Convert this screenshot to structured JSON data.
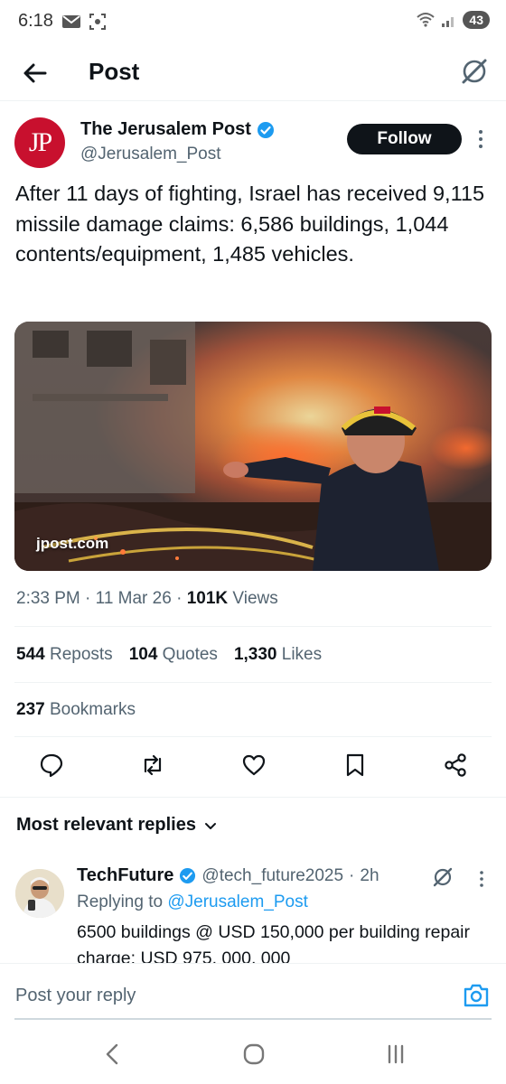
{
  "status": {
    "time": "6:18",
    "battery": "43"
  },
  "header": {
    "title": "Post"
  },
  "author": {
    "name": "The Jerusalem Post",
    "handle": "@Jerusalem_Post",
    "avatar_text": "JP",
    "follow_label": "Follow"
  },
  "post": {
    "text": "After 11 days of fighting, Israel has received 9,115 missile damage claims: 6,586 buildings, 1,044 contents/equipment, 1,485 vehicles.",
    "media_label": "jpost.com",
    "time": "2:33 PM",
    "date": "11 Mar 26",
    "views_count": "101K",
    "views_label": "Views"
  },
  "stats": {
    "reposts_count": "544",
    "reposts_label": "Reposts",
    "quotes_count": "104",
    "quotes_label": "Quotes",
    "likes_count": "1,330",
    "likes_label": "Likes",
    "bookmarks_count": "237",
    "bookmarks_label": "Bookmarks"
  },
  "replies": {
    "sort_label": "Most relevant replies",
    "items": [
      {
        "name": "TechFuture",
        "handle": "@tech_future2025",
        "age": "2h",
        "replying_prefix": "Replying to",
        "replying_to": "@Jerusalem_Post",
        "text": "6500 buildings @ USD 150,000 per building repair charge:  USD 975, 000, 000"
      }
    ]
  },
  "composer": {
    "placeholder": "Post your reply"
  },
  "colors": {
    "accent": "#1d9bf0",
    "text": "#0f1419",
    "muted": "#536471",
    "brand_red": "#c8102e"
  }
}
